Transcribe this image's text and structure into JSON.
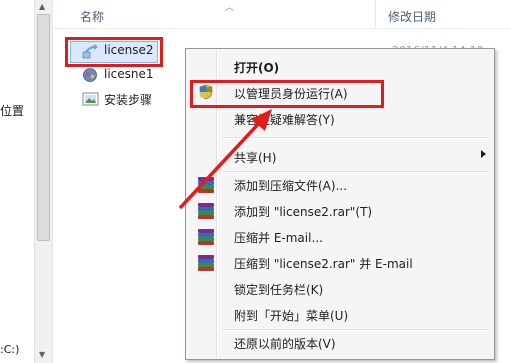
{
  "nav": {
    "item_location": "位置",
    "item_drive": ":C:)"
  },
  "header": {
    "col_name": "名称",
    "col_date": "修改日期"
  },
  "files": [
    {
      "name": "license2",
      "icon": "shortcut-icon",
      "date": "2016/11/4 14:10"
    },
    {
      "name": "licesne1",
      "icon": "registry-icon"
    },
    {
      "name": "安装步骤",
      "icon": "image-file-icon"
    }
  ],
  "context_menu": {
    "open": "打开(O)",
    "run_as_admin": "以管理员身份运行(A)",
    "troubleshoot": "兼容性疑难解答(Y)",
    "share": "共享(H)",
    "add_archive": "添加到压缩文件(A)...",
    "add_rar": "添加到 \"license2.rar\"(T)",
    "compress_email": "压缩并 E-mail...",
    "compress_rar_email": "压缩到 \"license2.rar\" 并 E-mail",
    "pin_taskbar": "锁定到任务栏(K)",
    "pin_start": "附到「开始」菜单(U)",
    "restore": "还原以前的版本(V)"
  },
  "colors": {
    "annotation_red": "#e21b1b",
    "menu_bg": "#f5f5f5",
    "header_text": "#4c607a"
  }
}
